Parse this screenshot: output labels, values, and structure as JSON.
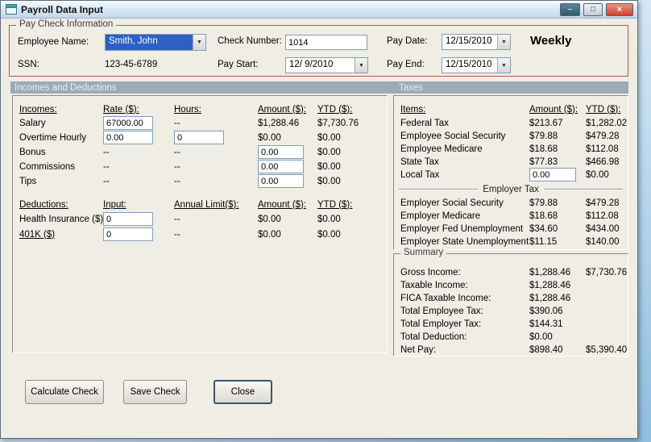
{
  "window": {
    "title": "Payroll Data Input",
    "minimize_glyph": "–",
    "maximize_glyph": "□",
    "close_glyph": "×"
  },
  "colors": {
    "group_border": "#b5564e",
    "section_bar": "#9cabb8",
    "selection_blue": "#2e5fc4",
    "close_red": "#d0402f"
  },
  "paycheck": {
    "group_label": "Pay Check Information",
    "employee_name": {
      "label": "Employee Name:",
      "value": "Smith, John"
    },
    "ssn": {
      "label": "SSN:",
      "value": "123-45-6789"
    },
    "check_number": {
      "label": "Check Number:",
      "value": "1014"
    },
    "pay_start": {
      "label": "Pay Start:",
      "value": "12/ 9/2010"
    },
    "pay_date": {
      "label": "Pay Date:",
      "value": "12/15/2010"
    },
    "pay_end": {
      "label": "Pay End:",
      "value": "12/15/2010"
    },
    "frequency": "Weekly"
  },
  "sections": {
    "incomes_and_deductions": "Incomes and Deductions",
    "taxes": "Taxes"
  },
  "incomes": {
    "headers": {
      "name": "Incomes:",
      "rate": "Rate ($):",
      "hours": "Hours:",
      "amount": "Amount ($):",
      "ytd": "YTD ($):"
    },
    "rows": [
      {
        "label": "Salary",
        "rate": "67000.00",
        "hours": "--",
        "amount": "$1,288.46",
        "ytd": "$7,730.76"
      },
      {
        "label": "Overtime Hourly",
        "rate": "0.00",
        "hours": "0",
        "amount": "$0.00",
        "ytd": "$0.00"
      },
      {
        "label": "Bonus",
        "rate": "--",
        "hours": "--",
        "amount": "0.00",
        "ytd": "$0.00"
      },
      {
        "label": "Commissions",
        "rate": "--",
        "hours": "--",
        "amount": "0.00",
        "ytd": "$0.00"
      },
      {
        "label": "Tips",
        "rate": "--",
        "hours": "--",
        "amount": "0.00",
        "ytd": "$0.00"
      }
    ]
  },
  "deductions": {
    "headers": {
      "name": "Deductions:",
      "input": "Input:",
      "limit": "Annual Limit($):",
      "amount": "Amount ($):",
      "ytd": "YTD ($):"
    },
    "rows": [
      {
        "label": "Health Insurance ($)",
        "input": "0",
        "limit": "--",
        "amount": "$0.00",
        "ytd": "$0.00"
      },
      {
        "label": "401K ($)",
        "input": "0",
        "limit": "--",
        "amount": "$0.00",
        "ytd": "$0.00"
      }
    ]
  },
  "taxes": {
    "headers": {
      "items": "Items:",
      "amount": "Amount ($):",
      "ytd": "YTD ($):"
    },
    "employee_rows": [
      {
        "label": "Federal Tax",
        "amount": "$213.67",
        "ytd": "$1,282.02"
      },
      {
        "label": "Employee Social Security",
        "amount": "$79.88",
        "ytd": "$479.28"
      },
      {
        "label": "Employee Medicare",
        "amount": "$18.68",
        "ytd": "$112.08"
      },
      {
        "label": "State Tax",
        "amount": "$77.83",
        "ytd": "$466.98"
      },
      {
        "label": "Local Tax",
        "amount": "0.00",
        "ytd": "$0.00"
      }
    ],
    "employer_header": "Employer Tax",
    "employer_rows": [
      {
        "label": "Employer Social Security",
        "amount": "$79.88",
        "ytd": "$479.28"
      },
      {
        "label": "Employer Medicare",
        "amount": "$18.68",
        "ytd": "$112.08"
      },
      {
        "label": "Employer Fed Unemployment",
        "amount": "$34.60",
        "ytd": "$434.00"
      },
      {
        "label": "Employer State Unemployment",
        "amount": "$11.15",
        "ytd": "$140.00"
      }
    ]
  },
  "summary": {
    "group_label": "Summary",
    "rows": [
      {
        "label": "Gross Income:",
        "value": "$1,288.46",
        "ytd": "$7,730.76"
      },
      {
        "label": "Taxable Income:",
        "value": "$1,288.46",
        "ytd": ""
      },
      {
        "label": "FICA Taxable Income:",
        "value": "$1,288.46",
        "ytd": ""
      },
      {
        "label": "Total Employee Tax:",
        "value": "$390.06",
        "ytd": ""
      },
      {
        "label": "Total Employer Tax:",
        "value": "$144.31",
        "ytd": ""
      },
      {
        "label": "Total Deduction:",
        "value": "$0.00",
        "ytd": ""
      },
      {
        "label": "Net Pay:",
        "value": "$898.40",
        "ytd": "$5,390.40"
      }
    ]
  },
  "buttons": {
    "calculate": "Calculate Check",
    "save": "Save Check",
    "close": "Close"
  }
}
